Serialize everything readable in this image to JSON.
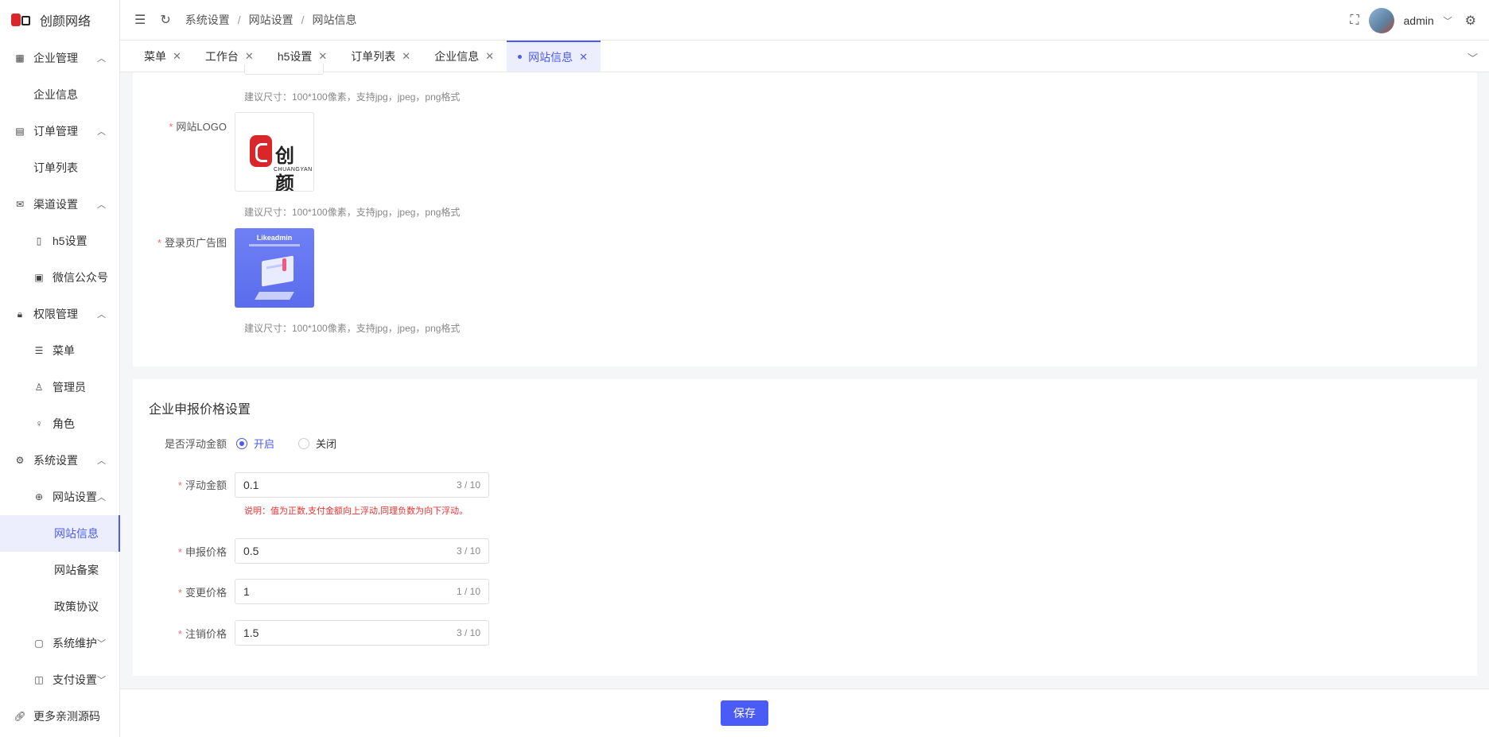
{
  "brand": {
    "name": "创颜网络"
  },
  "sidebar": {
    "items": [
      {
        "label": "企业管理",
        "icon": "building-icon",
        "chevron": "^"
      },
      {
        "label": "企业信息"
      },
      {
        "label": "订单管理",
        "icon": "document-icon",
        "chevron": "^"
      },
      {
        "label": "订单列表"
      },
      {
        "label": "渠道设置",
        "icon": "mail-icon",
        "chevron": "^"
      },
      {
        "label": "h5设置",
        "icon": "phone-icon"
      },
      {
        "label": "微信公众号",
        "icon": "wechat-icon"
      },
      {
        "label": "权限管理",
        "icon": "lock-icon",
        "chevron": "^"
      },
      {
        "label": "菜单",
        "icon": "sliders-icon"
      },
      {
        "label": "管理员",
        "icon": "user-icon"
      },
      {
        "label": "角色",
        "icon": "bulb-icon"
      },
      {
        "label": "系统设置",
        "icon": "gear-icon",
        "chevron": "^"
      },
      {
        "label": "网站设置",
        "icon": "globe-icon",
        "chevron": "^"
      },
      {
        "label": "网站信息"
      },
      {
        "label": "网站备案"
      },
      {
        "label": "政策协议"
      },
      {
        "label": "系统维护",
        "icon": "monitor-icon",
        "chevron": "v"
      },
      {
        "label": "支付设置",
        "icon": "wallet-icon",
        "chevron": "v"
      },
      {
        "label": "更多亲测源码",
        "icon": "link-icon"
      }
    ]
  },
  "header": {
    "breadcrumb": [
      "系统设置",
      "网站设置",
      "网站信息"
    ],
    "separator": "/",
    "username": "admin"
  },
  "tabs": [
    "菜单",
    "工作台",
    "h5设置",
    "订单列表",
    "企业信息",
    "网站信息"
  ],
  "site_info": {
    "hint": "建议尺寸：100*100像素，支持jpg，jpeg，png格式",
    "logo_label": "网站LOGO",
    "logo_text": "创颜",
    "logo_subtext": "CHUANGYAN",
    "ad_label": "登录页广告图",
    "ad_title": "Likeadmin"
  },
  "price": {
    "title": "企业申报价格设置",
    "float_label": "是否浮动金额",
    "on": "开启",
    "off": "关闭",
    "float_amount_label": "浮动金额",
    "float_amount": "0.1",
    "float_count": "3 / 10",
    "note": "说明：值为正数,支付金额向上浮动,同理负数为向下浮动。",
    "declare_label": "申报价格",
    "declare": "0.5",
    "declare_count": "3 / 10",
    "change_label": "变更价格",
    "change": "1",
    "change_count": "1 / 10",
    "cancel_label": "注销价格",
    "cancel": "1.5",
    "cancel_count": "3 / 10"
  },
  "footer": {
    "save": "保存"
  }
}
